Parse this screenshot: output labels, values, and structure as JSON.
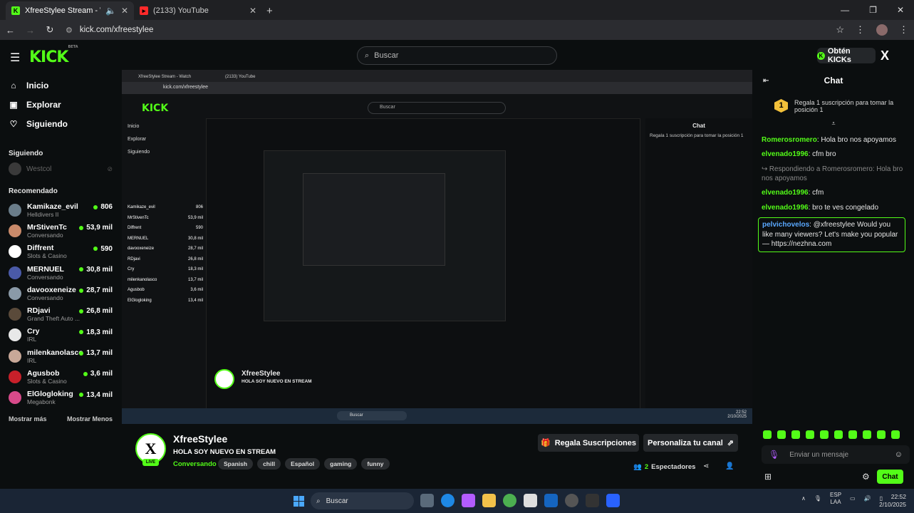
{
  "browser": {
    "tabs": [
      {
        "title": "XfreeStylee Stream - Watch",
        "active": true
      },
      {
        "title": "(2133) YouTube",
        "active": false
      }
    ],
    "url": "kick.com/xfreestylee"
  },
  "header": {
    "logo": "KICK",
    "logo_beta": "BETA",
    "search_placeholder": "Buscar",
    "kicks_label": "Obtén KICKs",
    "x_label": "X"
  },
  "sidebar": {
    "nav": [
      {
        "label": "Inicio",
        "icon": "home-icon"
      },
      {
        "label": "Explorar",
        "icon": "compass-icon"
      },
      {
        "label": "Siguiendo",
        "icon": "heart-icon"
      }
    ],
    "following_title": "Siguiendo",
    "following": [
      {
        "name": "Westcol"
      }
    ],
    "recommended_title": "Recomendado",
    "recommended": [
      {
        "name": "Kamikaze_evil",
        "category": "Helldivers II",
        "viewers": "806",
        "color": "#6a7d8a"
      },
      {
        "name": "MrStivenTc",
        "category": "Conversando",
        "viewers": "53,9 mil",
        "color": "#c98a6a"
      },
      {
        "name": "Diffrent",
        "category": "Slots & Casino",
        "viewers": "590",
        "color": "#ffffff"
      },
      {
        "name": "MERNUEL",
        "category": "Conversando",
        "viewers": "30,8 mil",
        "color": "#4a5aa8"
      },
      {
        "name": "davooxeneize",
        "category": "Conversando",
        "viewers": "28,7 mil",
        "color": "#8a9aa8"
      },
      {
        "name": "RDjavi",
        "category": "Grand Theft Auto ...",
        "viewers": "26,8 mil",
        "color": "#5a4a3a"
      },
      {
        "name": "Cry",
        "category": "IRL",
        "viewers": "18,3 mil",
        "color": "#e8e8e8"
      },
      {
        "name": "milenkanolasco",
        "category": "IRL",
        "viewers": "13,7 mil",
        "color": "#c8a898"
      },
      {
        "name": "Agusbob",
        "category": "Slots & Casino",
        "viewers": "3,6 mil",
        "color": "#c8202a"
      },
      {
        "name": "ElGlogloking",
        "category": "Megabonk",
        "viewers": "13,4 mil",
        "color": "#d84a8a"
      }
    ],
    "show_more": "Mostrar más",
    "show_less": "Mostrar Menos"
  },
  "stream": {
    "streamer": "XfreeStylee",
    "live_badge": "LIVE",
    "title": "HOLA SOY NUEVO EN STREAM",
    "category": "Conversando",
    "tags": [
      "Spanish",
      "chill",
      "Español",
      "gaming",
      "funny"
    ],
    "gift_subs_label": "Regala Suscripciones",
    "customize_label": "Personaliza tu canal",
    "viewers_count": "2",
    "viewers_label": "Espectadores"
  },
  "chat": {
    "title": "Chat",
    "pin_rank": "1",
    "pin_text": "Regala 1 suscripción para tomar la posición 1",
    "messages": [
      {
        "user": "Romerosromero",
        "text": "Hola bro nos apoyamos",
        "type": "normal"
      },
      {
        "user": "elvenado1996",
        "text": "cfm bro",
        "type": "normal"
      },
      {
        "user": "",
        "text": "↪ Respondiendo a Romerosromero: Hola bro nos apoyamos",
        "type": "reply"
      },
      {
        "user": "elvenado1996",
        "text": "cfm",
        "type": "normal"
      },
      {
        "user": "elvenado1996",
        "text": "bro te ves congelado",
        "type": "normal"
      },
      {
        "user": "pelvichovelos",
        "text": "@xfreestylee Would you like many viewers? Let's make you popular — https://nezhna.com",
        "type": "highlight"
      }
    ],
    "input_placeholder": "Enviar un mensaje",
    "send_label": "Chat"
  },
  "player": {
    "inner_url": "kick.com/xfreestylee",
    "inner_tabs": [
      "XfreeStylee Stream - Watch",
      "(2133) YouTube"
    ],
    "inner_chat_title": "Chat"
  },
  "taskbar": {
    "search_label": "Buscar",
    "lang_top": "ESP",
    "lang_bottom": "LAA",
    "time": "22:52",
    "date": "2/10/2025",
    "inner_time": "22:52",
    "inner_date": "2/10/2025"
  }
}
